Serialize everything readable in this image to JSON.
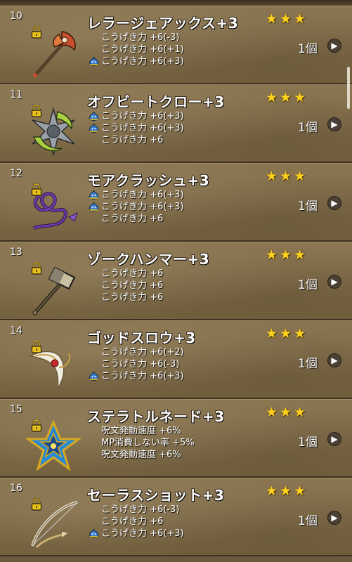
{
  "items": [
    {
      "number": "10",
      "name": "レラージェアックス+3",
      "weapon_icon": "axe-icon",
      "stats": [
        {
          "text": "こうげき力 +6(-3)",
          "slime": false
        },
        {
          "text": "こうげき力 +6(+1)",
          "slime": false
        },
        {
          "text": "こうげき力 +6(+3)",
          "slime": true
        }
      ],
      "count": "1個"
    },
    {
      "number": "11",
      "name": "オフビートクロー+3",
      "weapon_icon": "claw-icon",
      "stats": [
        {
          "text": "こうげき力 +6(+3)",
          "slime": true
        },
        {
          "text": "こうげき力 +6(+3)",
          "slime": true
        },
        {
          "text": "こうげき力 +6",
          "slime": false
        }
      ],
      "count": "1個"
    },
    {
      "number": "12",
      "name": "モアクラッシュ+3",
      "weapon_icon": "whip-icon",
      "stats": [
        {
          "text": "こうげき力 +6(+3)",
          "slime": true
        },
        {
          "text": "こうげき力 +6(+3)",
          "slime": true
        },
        {
          "text": "こうげき力 +6",
          "slime": false
        }
      ],
      "count": "1個"
    },
    {
      "number": "13",
      "name": "ゾークハンマー+3",
      "weapon_icon": "hammer-icon",
      "stats": [
        {
          "text": "こうげき力 +6",
          "slime": false
        },
        {
          "text": "こうげき力 +6",
          "slime": false
        },
        {
          "text": "こうげき力 +6",
          "slime": false
        }
      ],
      "count": "1個"
    },
    {
      "number": "14",
      "name": "ゴッドスロウ+3",
      "weapon_icon": "boomerang-icon",
      "stats": [
        {
          "text": "こうげき力 +6(+2)",
          "slime": false
        },
        {
          "text": "こうげき力 +6(-3)",
          "slime": false
        },
        {
          "text": "こうげき力 +6(+3)",
          "slime": true
        }
      ],
      "count": "1個"
    },
    {
      "number": "15",
      "name": "ステラトルネード+3",
      "weapon_icon": "star-boomerang-icon",
      "stats": [
        {
          "text": "呪文発動速度 +6%",
          "slime": false
        },
        {
          "text": "MP消費しない率 +5%",
          "slime": false
        },
        {
          "text": "呪文発動速度 +6%",
          "slime": false
        }
      ],
      "count": "1個"
    },
    {
      "number": "16",
      "name": "セーラスショット+3",
      "weapon_icon": "bow-icon",
      "stats": [
        {
          "text": "こうげき力 +6(-3)",
          "slime": false
        },
        {
          "text": "こうげき力 +6",
          "slime": false
        },
        {
          "text": "こうげき力 +6(+3)",
          "slime": true
        }
      ],
      "count": "1個"
    }
  ],
  "colors": {
    "star": "#ffd21f",
    "lock": "#e8c21a",
    "slime": "#3a7fd0"
  }
}
